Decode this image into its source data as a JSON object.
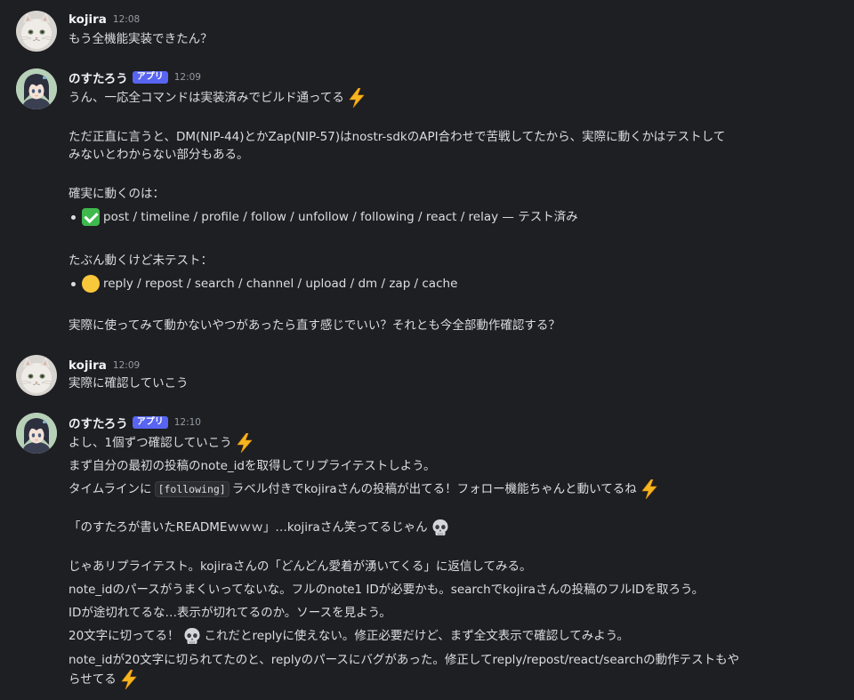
{
  "messages": [
    {
      "author": "kojira",
      "time": "12:08",
      "lines": [
        "もう全機能実装できたん？"
      ]
    },
    {
      "author": "のすたろう",
      "badge": "アプリ",
      "time": "12:09",
      "line1": "うん、一応全コマンドは実装済みでビルド通ってる",
      "line2": "ただ正直に言うと、DM(NIP-44)とかZap(NIP-57)はnostr-sdkのAPI合わせで苦戦してたから、実際に動くかはテストして",
      "line3": "みないとわからない部分もある。",
      "line4": "確実に動くのは：",
      "bullet1": "post / timeline / profile / follow / unfollow / following / react / relay — テスト済み",
      "line5": "たぶん動くけど未テスト：",
      "bullet2": "reply / repost / search / channel / upload / dm / zap / cache",
      "line6": "実際に使ってみて動かないやつがあったら直す感じでいい？それとも今全部動作確認する？"
    },
    {
      "author": "kojira",
      "time": "12:09",
      "lines": [
        "実際に確認していこう"
      ]
    },
    {
      "author": "のすたろう",
      "badge": "アプリ",
      "time": "12:10",
      "line1": "よし、1個ずつ確認していこう",
      "line2": "まず自分の最初の投稿のnote_idを取得してリプライテストしよう。",
      "line3a": "タイムラインに",
      "line3code": "[following]",
      "line3b": "ラベル付きでkojiraさんの投稿が出てる！フォロー機能ちゃんと動いてるね",
      "line4": "「のすたろが書いたREADMEｗｗｗ」…kojiraさん笑ってるじゃん",
      "line5": "じゃあリプライテスト。kojiraさんの「どんどん愛着が湧いてくる」に返信してみる。",
      "line6": "note_idのパースがうまくいってないな。フルのnote1 IDが必要かも。searchでkojiraさんの投稿のフルIDを取ろう。",
      "line7": "IDが途切れてるな…表示が切れてるのか。ソースを見よう。",
      "line8a": "20文字に切ってる！",
      "line8b": "これだとreplyに使えない。修正必要だけど、まず全文表示で確認してみよう。",
      "line9": "note_idが20文字に切られてたのと、replyのパースにバグがあった。修正してreply/repost/react/searchの動作テストもや",
      "line10": "らせてる"
    }
  ],
  "icons": {
    "bolt": "high-voltage-emoji",
    "check": "check-mark-button-emoji",
    "circle": "yellow-circle-emoji",
    "skull": "skull-emoji"
  },
  "colors": {
    "background": "#1e1f22",
    "text": "#dbdee1",
    "author": "#f2f3f5",
    "timestamp": "#949ba4",
    "badge": "#5865f2"
  }
}
